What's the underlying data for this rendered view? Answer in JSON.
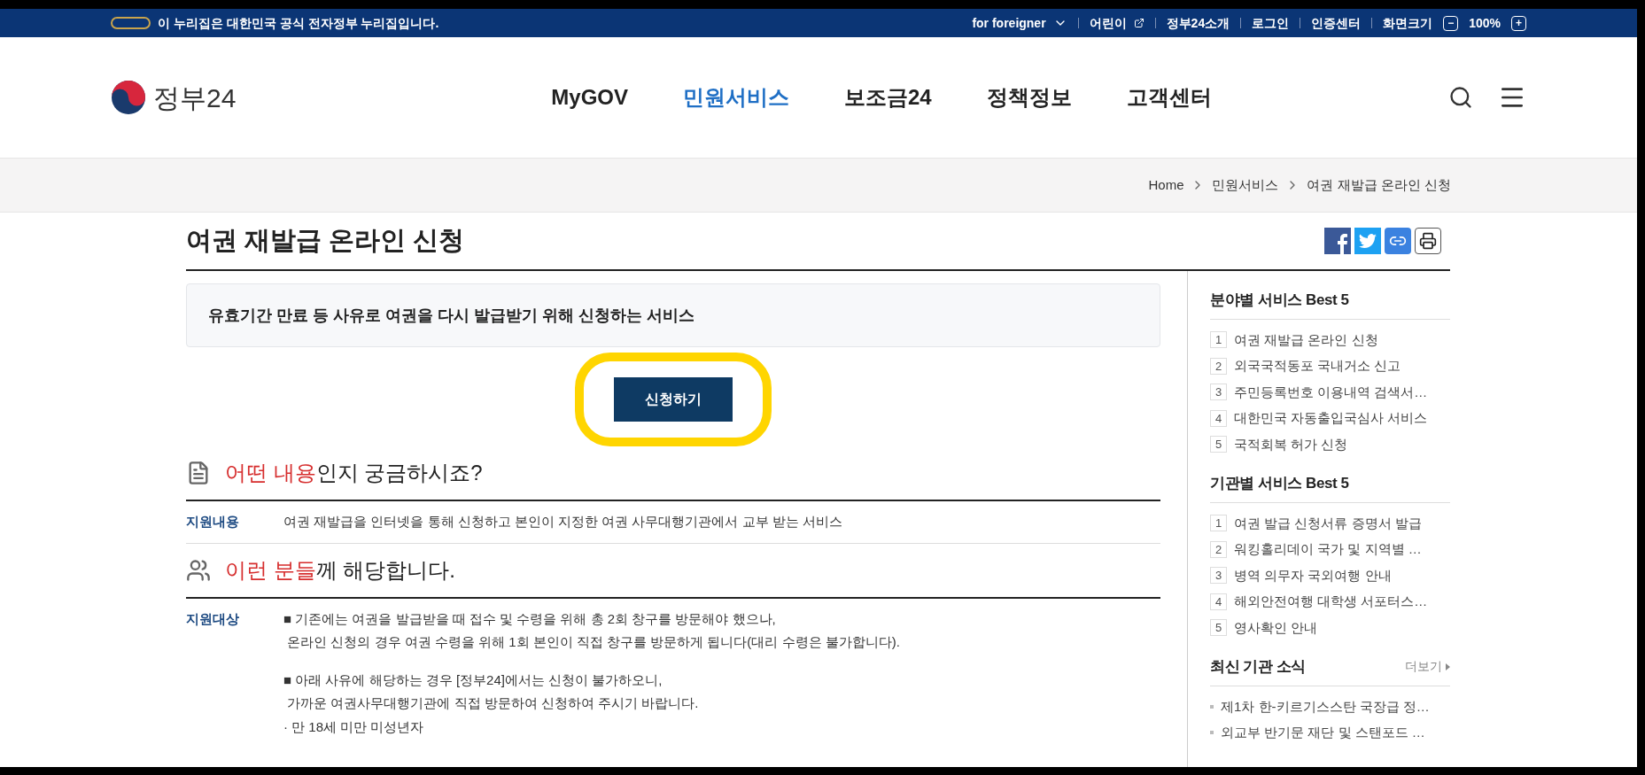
{
  "gov_banner": {
    "text": "이 누리집은 대한민국 공식 전자정부 누리집입니다."
  },
  "utility_links": [
    {
      "label": "for foreigner",
      "kind": "dropdown"
    },
    {
      "label": "어린이",
      "kind": "external"
    },
    {
      "label": "정부24소개",
      "kind": "plain"
    },
    {
      "label": "로그인",
      "kind": "plain"
    },
    {
      "label": "인증센터",
      "kind": "plain"
    }
  ],
  "zoom": {
    "label": "화면크기",
    "minus": "−",
    "value": "100%",
    "plus": "+"
  },
  "logo": {
    "text": "정부24"
  },
  "nav": [
    {
      "label": "MyGOV",
      "selected": false
    },
    {
      "label": "민원서비스",
      "selected": true
    },
    {
      "label": "보조금24",
      "selected": false
    },
    {
      "label": "정책정보",
      "selected": false
    },
    {
      "label": "고객센터",
      "selected": false
    }
  ],
  "breadcrumb": [
    "Home",
    "민원서비스",
    "여권 재발급 온라인 신청"
  ],
  "page_title": "여권 재발급 온라인 신청",
  "summary": "유효기간 만료 등 사유로 여권을 다시 발급받기 위해 신청하는 서비스",
  "apply_button": {
    "label": "신청하기",
    "highlighted": true
  },
  "sections": [
    {
      "highlight": "어떤 내용",
      "rest": "인지 궁금하시죠?",
      "label": "지원내용",
      "paragraphs": [
        [
          "여권 재발급을 인터넷을 통해 신청하고 본인이 지정한 여권 사무대행기관에서 교부 받는 서비스"
        ]
      ]
    },
    {
      "highlight": "이런 분들",
      "rest": "께 해당합니다.",
      "label": "지원대상",
      "paragraphs": [
        [
          "■ 기존에는 여권을 발급받을 때 접수 및 수령을 위해 총 2회 창구를 방문해야 했으나,",
          " 온라인 신청의 경우 여권 수령을 위해 1회 본인이 직접 창구를 방문하게 됩니다(대리 수령은 불가합니다)."
        ],
        [
          "■ 아래 사유에 해당하는 경우 [정부24]에서는 신청이 불가하오니,",
          " 가까운 여권사무대행기관에 직접 방문하여 신청하여 주시기 바랍니다.",
          "· 만 18세 미만 미성년자"
        ]
      ]
    }
  ],
  "sidebar": [
    {
      "title": "분야별 서비스 Best 5",
      "kind": "ranked",
      "items": [
        {
          "rank": "1",
          "text": "여권 재발급 온라인 신청"
        },
        {
          "rank": "2",
          "text": "외국국적동포 국내거소 신고"
        },
        {
          "rank": "3",
          "text": "주민등록번호 이용내역 검색서…"
        },
        {
          "rank": "4",
          "text": "대한민국 자동출입국심사 서비스"
        },
        {
          "rank": "5",
          "text": "국적회복 허가 신청"
        }
      ]
    },
    {
      "title": "기관별 서비스 Best 5",
      "kind": "ranked",
      "items": [
        {
          "rank": "1",
          "text": "여권 발급 신청서류 증명서 발급"
        },
        {
          "rank": "2",
          "text": "워킹홀리데이 국가 및 지역별 …"
        },
        {
          "rank": "3",
          "text": "병역 의무자 국외여행 안내"
        },
        {
          "rank": "4",
          "text": "해외안전여행 대학생 서포터스…"
        },
        {
          "rank": "5",
          "text": "영사확인 안내"
        }
      ]
    },
    {
      "title": "최신 기관 소식",
      "kind": "news",
      "more": "더보기",
      "items": [
        {
          "text": "제1차 한-키르기스스탄 국장급 정…"
        },
        {
          "text": "외교부 반기문 재단 및 스탠포드 …"
        }
      ]
    }
  ]
}
